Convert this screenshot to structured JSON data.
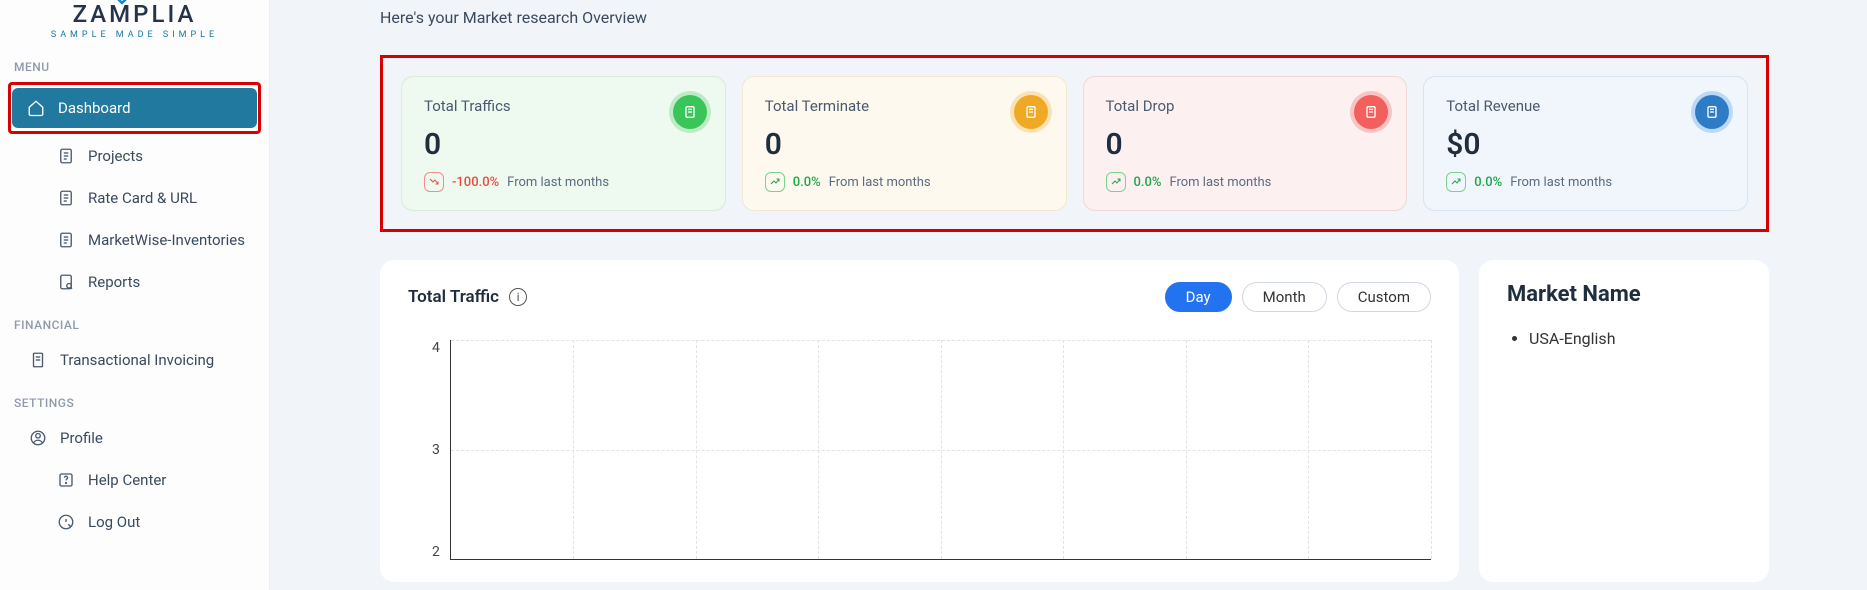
{
  "brand": {
    "name": "ZAMPLIA",
    "tagline": "SAMPLE MADE SIMPLE"
  },
  "sidebar": {
    "section_menu": "MENU",
    "section_financial": "FINANCIAL",
    "section_settings": "SETTINGS",
    "dashboard": "Dashboard",
    "projects": "Projects",
    "rate_card": "Rate Card & URL",
    "marketwise": "MarketWise-Inventories",
    "reports": "Reports",
    "invoicing": "Transactional Invoicing",
    "profile": "Profile",
    "help": "Help Center",
    "logout": "Log Out"
  },
  "subtitle": "Here's your Market research Overview",
  "stats": {
    "traffics": {
      "title": "Total Traffics",
      "value": "0",
      "pct": "-100.0%",
      "label": "From last months"
    },
    "terminate": {
      "title": "Total Terminate",
      "value": "0",
      "pct": "0.0%",
      "label": "From last months"
    },
    "drop": {
      "title": "Total Drop",
      "value": "0",
      "pct": "0.0%",
      "label": "From last months"
    },
    "revenue": {
      "title": "Total Revenue",
      "value": "$0",
      "pct": "0.0%",
      "label": "From last months"
    }
  },
  "chart_panel": {
    "title": "Total Traffic",
    "tabs": {
      "day": "Day",
      "month": "Month",
      "custom": "Custom"
    }
  },
  "market_panel": {
    "title": "Market Name",
    "items": [
      "USA-English"
    ]
  },
  "chart_data": {
    "type": "line",
    "title": "Total Traffic",
    "xlabel": "",
    "ylabel": "",
    "ylim": [
      0,
      4
    ],
    "y_ticks": [
      4,
      3,
      2
    ],
    "categories": [],
    "values": []
  }
}
